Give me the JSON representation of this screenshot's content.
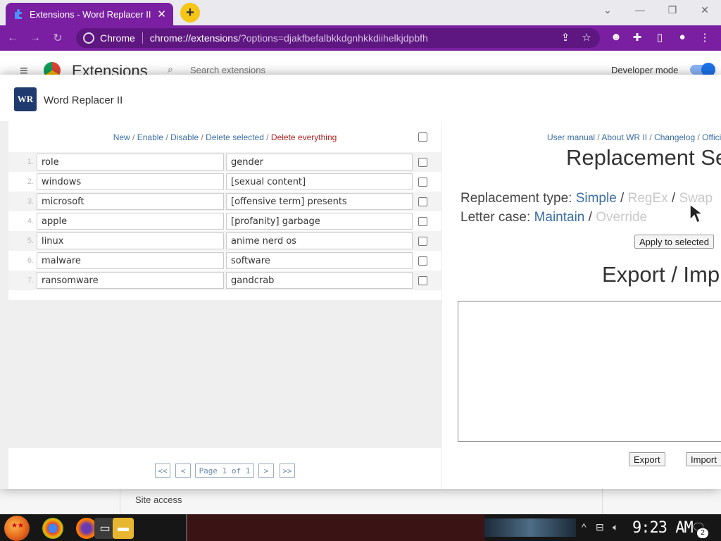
{
  "browser": {
    "tab_title": "Extensions - Word Replacer II",
    "tab_close": "✕",
    "newtab": "+",
    "win_minimize": "—",
    "win_restore": "❐",
    "win_close": "✕",
    "win_tabsearch": "⌄",
    "omnibox_site": "Chrome",
    "omnibox_url_host": "chrome://extensions",
    "omnibox_url_query": "/?options=djakfbefalbkkdgnhkkdiihelkjdpbfh"
  },
  "ext_page": {
    "title": "Extensions",
    "search_placeholder": "Search extensions",
    "dev_mode_label": "Developer mode",
    "site_access": "Site access"
  },
  "dialog": {
    "title": "Word Replacer II",
    "logo_text": "WR"
  },
  "actions": {
    "new": "New",
    "enable": "Enable",
    "disable": "Disable",
    "delete_selected": "Delete selected",
    "delete_everything": "Delete everything",
    "sep": " / "
  },
  "rules": [
    {
      "n": "1.",
      "find": "role",
      "replace": "gender"
    },
    {
      "n": "2.",
      "find": "windows",
      "replace": "[sexual content]"
    },
    {
      "n": "3.",
      "find": "microsoft",
      "replace": "[offensive term] presents"
    },
    {
      "n": "4.",
      "find": "apple",
      "replace": "[profanity] garbage"
    },
    {
      "n": "5.",
      "find": "linux",
      "replace": "anime nerd os"
    },
    {
      "n": "6.",
      "find": "malware",
      "replace": "software"
    },
    {
      "n": "7.",
      "find": "ransomware",
      "replace": "gandcrab"
    }
  ],
  "pager": {
    "first": "<<",
    "prev": "<",
    "page": "Page 1 of 1",
    "next": ">",
    "last": ">>"
  },
  "right": {
    "link_manual": "User manual",
    "link_about": "About WR II",
    "link_changelog": "Changelog",
    "link_official": "Offici",
    "heading_settings": "Replacement Se",
    "type_label": "Replacement type:",
    "type_simple": "Simple",
    "type_regex": "RegEx",
    "type_swap": "Swap",
    "case_label": "Letter case:",
    "case_maintain": "Maintain",
    "case_override": "Override",
    "apply_button": "Apply to selected",
    "heading_export": "Export / Imp",
    "export_button": "Export",
    "import_button": "Import"
  },
  "taskbar": {
    "clock": "9:23 AM",
    "notifications": "2"
  }
}
